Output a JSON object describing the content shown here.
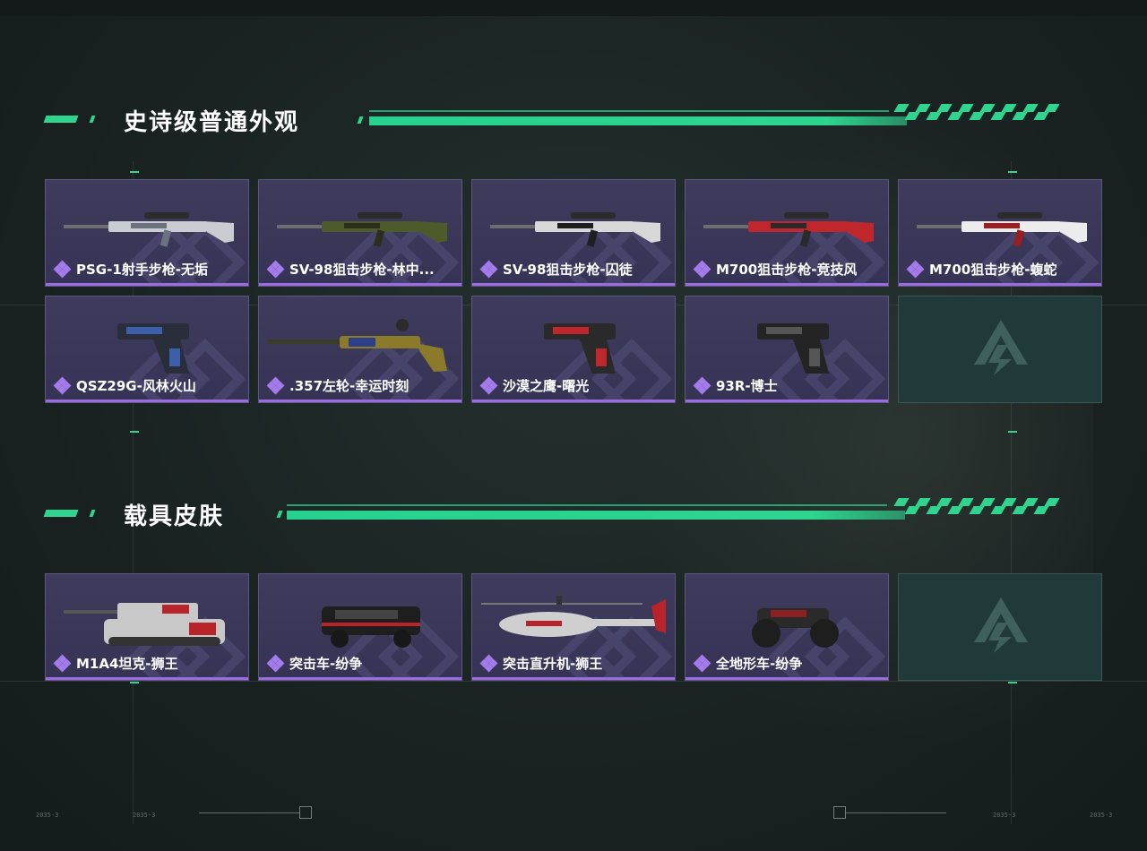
{
  "sections": [
    {
      "title": "史诗级普通外观",
      "items": [
        {
          "name": "PSG-1射手步枪-无垢",
          "kind": "rifle",
          "palette": [
            "#c9ccd0",
            "#6a7280"
          ]
        },
        {
          "name": "SV-98狙击步枪-林中...",
          "kind": "rifle",
          "palette": [
            "#4d5a2a",
            "#2b2f1c"
          ]
        },
        {
          "name": "SV-98狙击步枪-囚徒",
          "kind": "rifle",
          "palette": [
            "#d8d8d8",
            "#1f1f1f"
          ]
        },
        {
          "name": "M700狙击步枪-竞技风",
          "kind": "rifle",
          "palette": [
            "#c0272d",
            "#2a2a2a"
          ]
        },
        {
          "name": "M700狙击步枪-蝮蛇",
          "kind": "rifle",
          "palette": [
            "#ececec",
            "#9a1e22"
          ]
        },
        {
          "name": "QSZ29G-风林火山",
          "kind": "pistol",
          "palette": [
            "#2a2e3a",
            "#3b5fa8"
          ]
        },
        {
          "name": ".357左轮-幸运时刻",
          "kind": "revolver",
          "palette": [
            "#8a7a2a",
            "#2c3f8a"
          ]
        },
        {
          "name": "沙漠之鹰-曙光",
          "kind": "pistol",
          "palette": [
            "#2a2a2a",
            "#c0272d"
          ]
        },
        {
          "name": "93R-博士",
          "kind": "pistol",
          "palette": [
            "#242424",
            "#555555"
          ]
        },
        {
          "name": "",
          "kind": "empty"
        }
      ]
    },
    {
      "title": "载具皮肤",
      "items": [
        {
          "name": "M1A4坦克-狮王",
          "kind": "tank",
          "palette": [
            "#c8c8c8",
            "#b8242a"
          ]
        },
        {
          "name": "突击车-纷争",
          "kind": "car",
          "palette": [
            "#1e1e1e",
            "#b8242a"
          ]
        },
        {
          "name": "突击直升机-狮王",
          "kind": "heli",
          "palette": [
            "#cfcfcf",
            "#b8242a"
          ]
        },
        {
          "name": "全地形车-纷争",
          "kind": "atv",
          "palette": [
            "#2a2a2a",
            "#8a2020"
          ]
        },
        {
          "name": "",
          "kind": "empty"
        }
      ]
    }
  ],
  "decor": {
    "bottom_left_marks": [
      "2035-3",
      "2035-3"
    ],
    "bottom_right_marks": [
      "2035-3",
      "2035-3"
    ]
  }
}
